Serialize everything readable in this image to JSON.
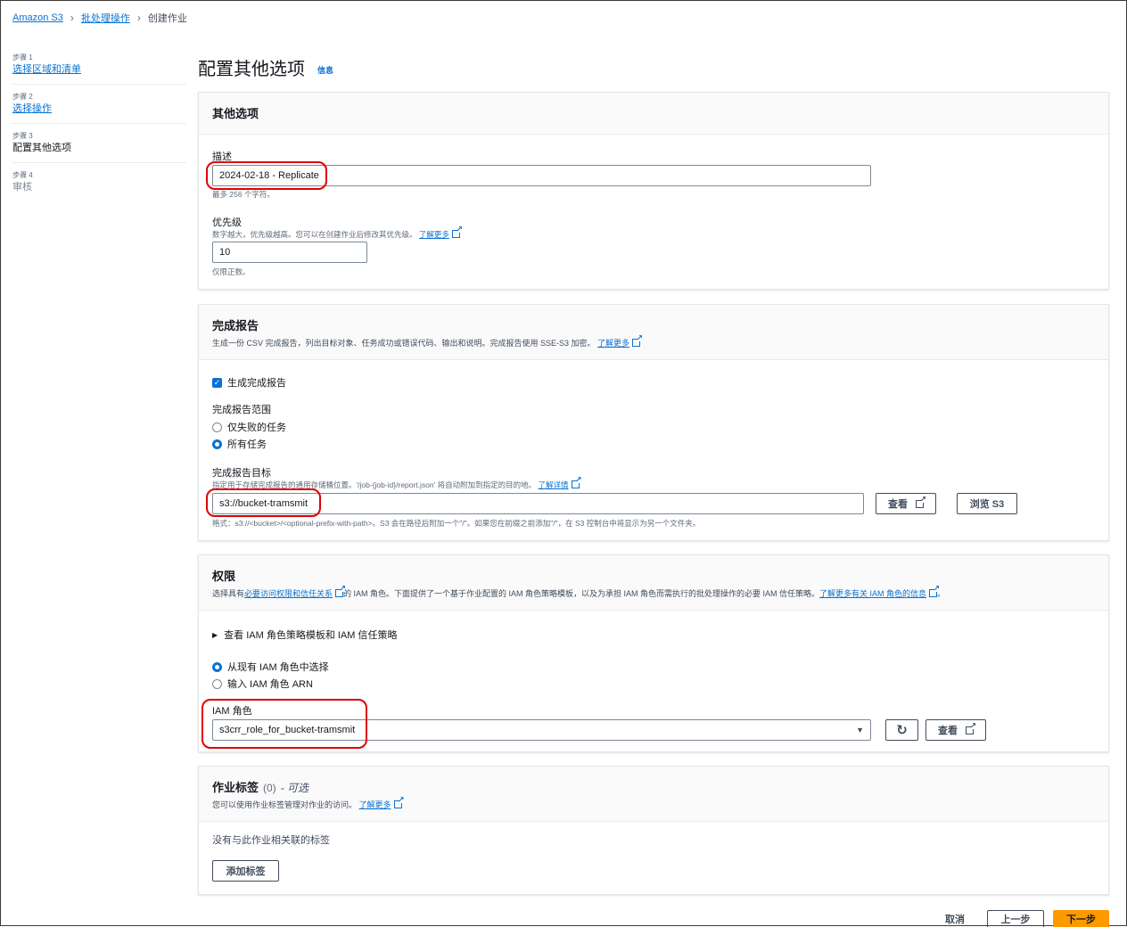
{
  "breadcrumb": {
    "items": [
      "Amazon S3",
      "批处理操作"
    ],
    "current": "创建作业"
  },
  "sidenav": {
    "steps": [
      {
        "num": "步骤 1",
        "label": "选择区域和清单"
      },
      {
        "num": "步骤 2",
        "label": "选择操作"
      },
      {
        "num": "步骤 3",
        "label": "配置其他选项"
      },
      {
        "num": "步骤 4",
        "label": "审核"
      }
    ]
  },
  "header": {
    "title": "配置其他选项",
    "info": "信息"
  },
  "other_options": {
    "title": "其他选项",
    "description_label": "描述",
    "description_value": "2024-02-18 - Replicate",
    "description_hint": "最多 256 个字符。",
    "priority_label": "优先级",
    "priority_hint": "数字越大，优先级越高。您可以在创建作业后修改其优先级。",
    "priority_learn_more": "了解更多",
    "priority_value": "10",
    "priority_constraint": "仅限正数。"
  },
  "completion_report": {
    "title": "完成报告",
    "desc": "生成一份 CSV 完成报告，列出目标对象、任务成功或错误代码、输出和说明。完成报告使用 SSE-S3 加密。",
    "learn_more": "了解更多",
    "generate_label": "生成完成报告",
    "scope_label": "完成报告范围",
    "scope_options": [
      "仅失败的任务",
      "所有任务"
    ],
    "scope_selected": 1,
    "dest_label": "完成报告目标",
    "dest_hint": "指定用于存储完成报告的通用存储桶位置。'/job-{job-id}/report.json' 将自动附加到指定的目的地。",
    "dest_learn": "了解详情",
    "dest_value": "s3://bucket-tramsmit",
    "view_button": "查看",
    "browse_button": "浏览 S3",
    "format_hint": "格式：s3://<bucket>/<optional-prefix-with-path>。S3 会在路径后附加一个\"/\"。如果您在前缀之前添加\"/\"，在 S3 控制台中将显示为另一个文件夹。"
  },
  "permissions": {
    "title": "权限",
    "desc_pre": "选择具有",
    "desc_link": "必要访问权限和信任关系",
    "desc_post": "的 IAM 角色。下面提供了一个基于作业配置的 IAM 角色策略模板，以及为承担 IAM 角色而需执行的批处理操作的必要 IAM 信任策略。",
    "desc_link2": "了解更多有关 IAM 角色的信息",
    "expander": "查看 IAM 角色策略模板和 IAM 信任策略",
    "options": [
      "从现有 IAM 角色中选择",
      "输入 IAM 角色 ARN"
    ],
    "selected": 0,
    "role_label": "IAM 角色",
    "role_value": "s3crr_role_for_bucket-tramsmit",
    "view_button": "查看"
  },
  "job_tags": {
    "title": "作业标签",
    "count": "(0)",
    "optional": "- 可选",
    "desc": "您可以使用作业标签管理对作业的访问。",
    "learn_more": "了解更多",
    "empty": "没有与此作业相关联的标签",
    "add_button": "添加标签"
  },
  "footer": {
    "cancel": "取消",
    "previous": "上一步",
    "next": "下一步"
  },
  "colors": {
    "link": "#0972d3",
    "primary": "#ff9900",
    "highlight": "#e00000"
  }
}
